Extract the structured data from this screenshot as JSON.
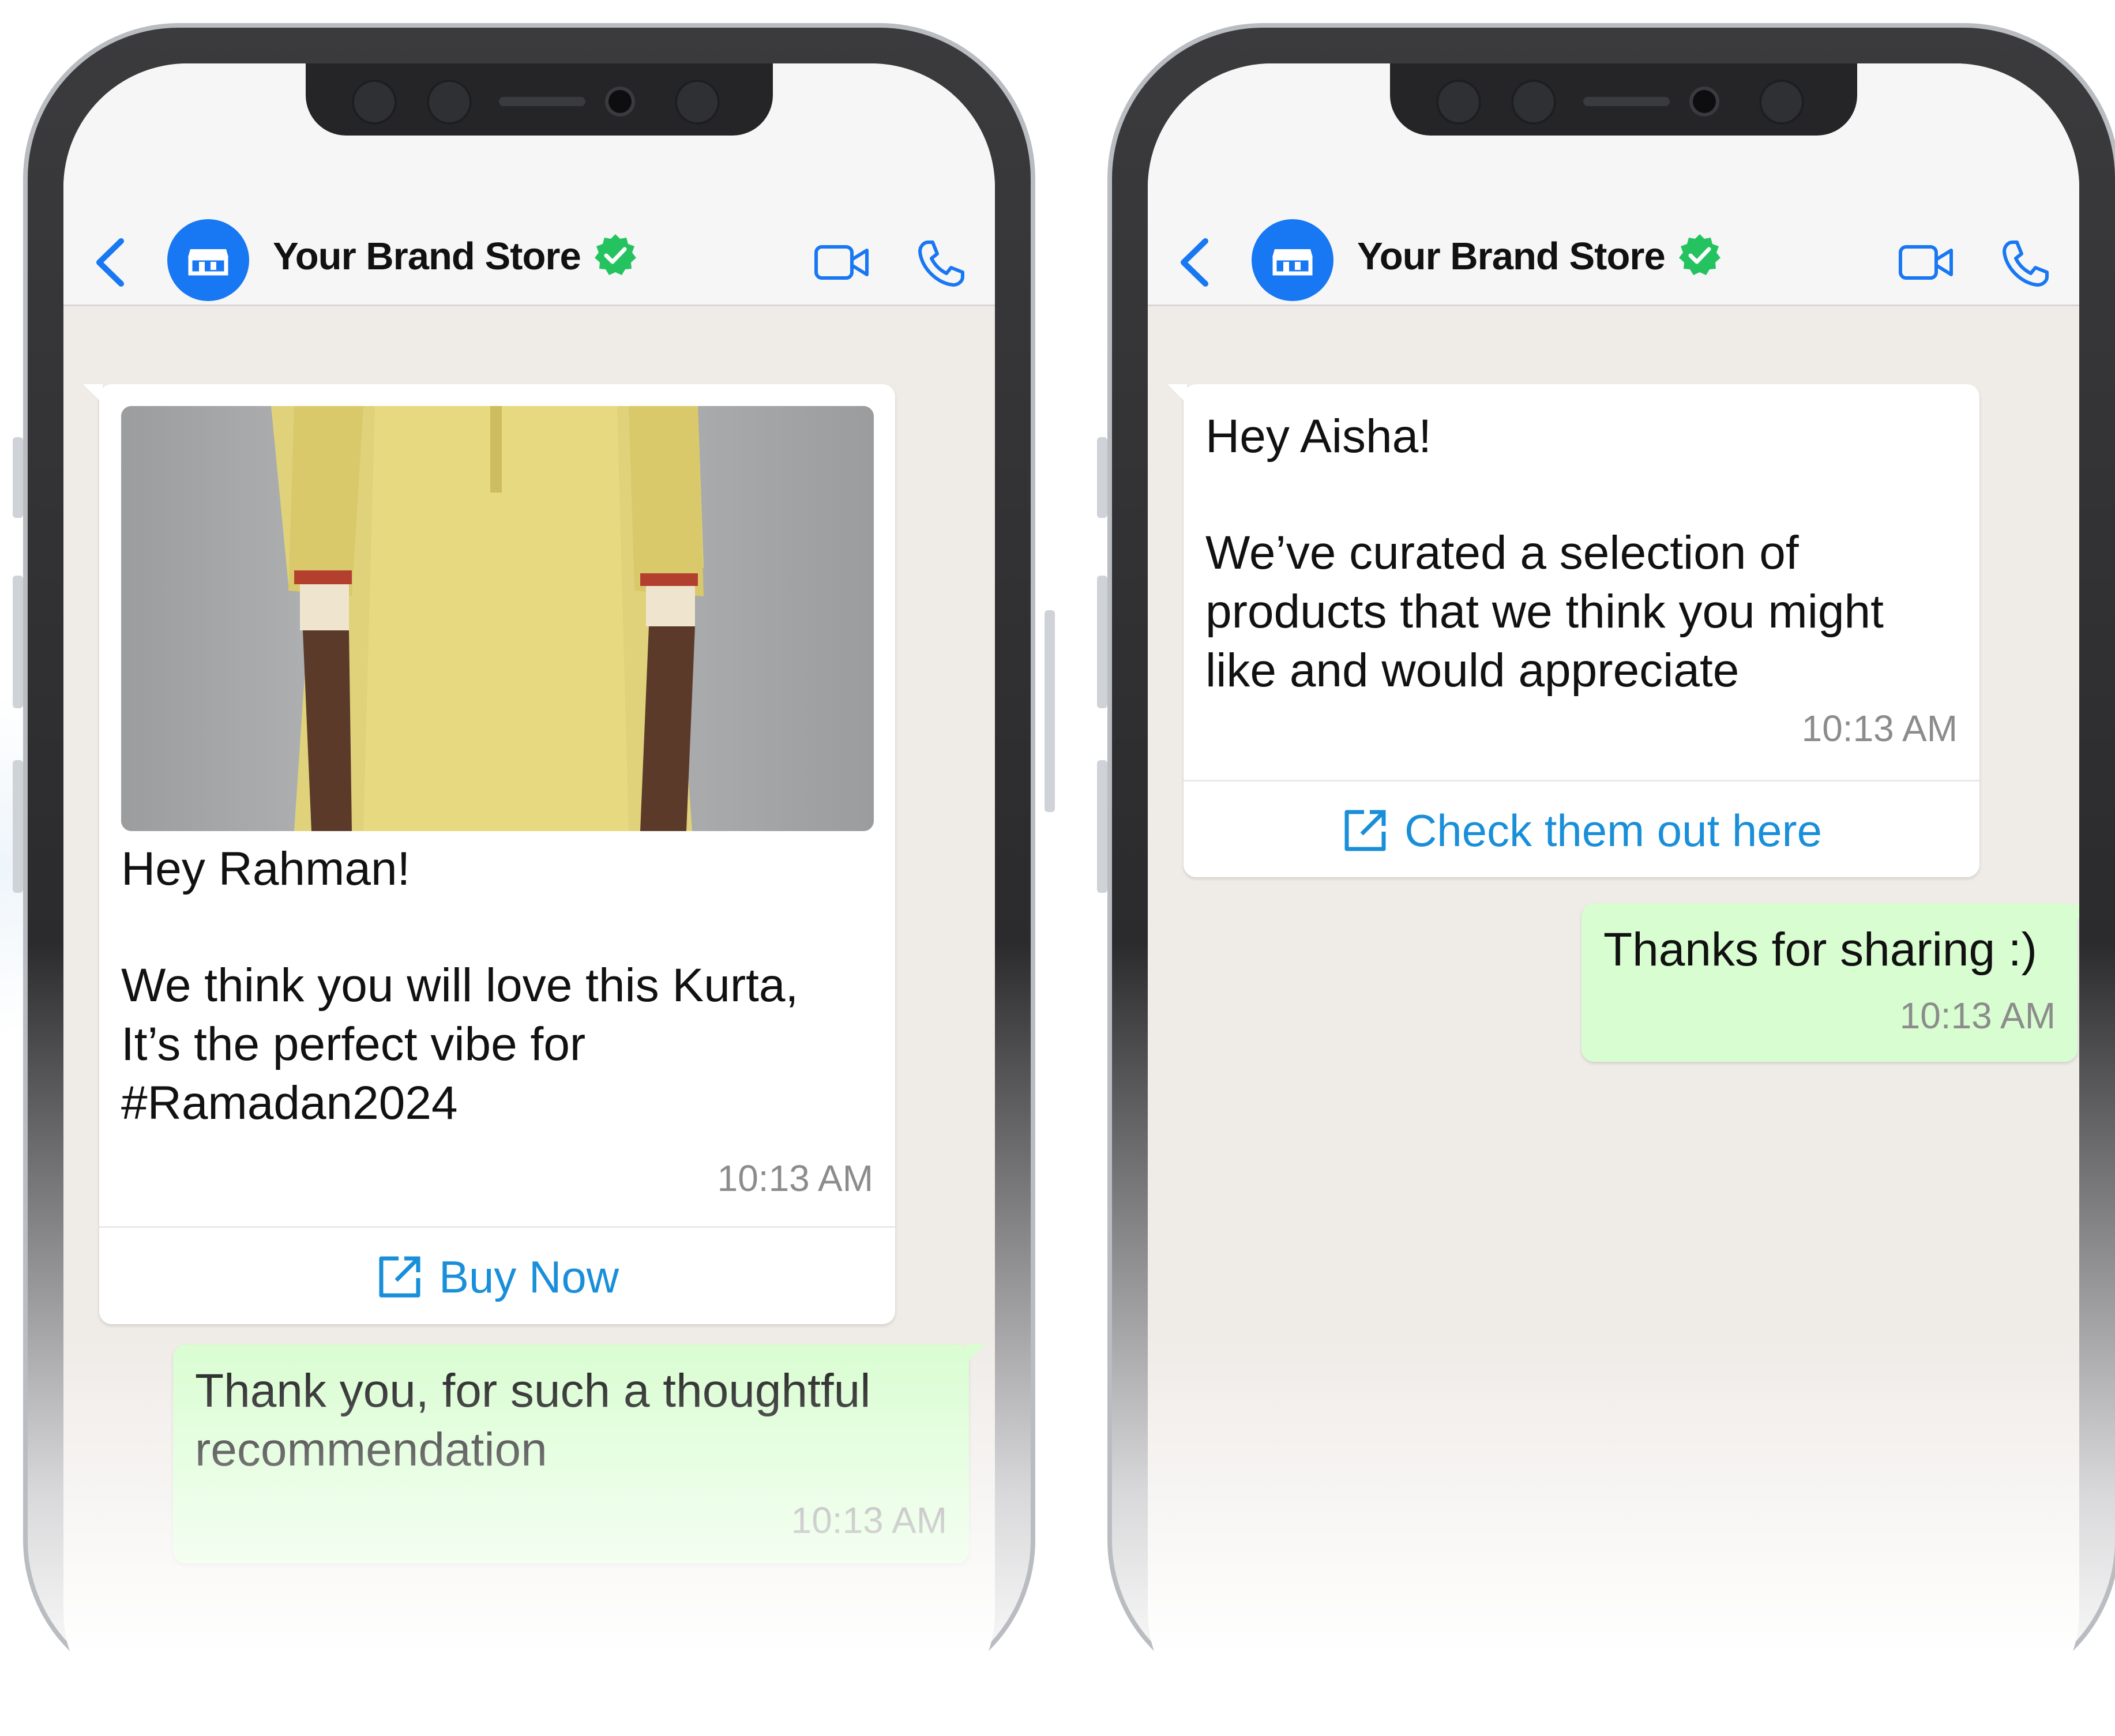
{
  "colors": {
    "brand_blue": "#1877f2",
    "verified_green": "#25c360",
    "outgoing_bubble": "#d8fdd0",
    "link_blue": "#1a8fd9",
    "chat_bg": "#efebe7"
  },
  "phones": [
    {
      "header": {
        "back_icon": "chevron-left-icon",
        "avatar_icon": "store-icon",
        "title": "Your Brand Store",
        "verified_icon": "verified-badge-icon",
        "video_icon": "video-call-icon",
        "call_icon": "phone-call-icon"
      },
      "messages": {
        "incoming": {
          "image": "yellow kurta product photo",
          "greeting": "Hey Rahman!",
          "body": "We think you will love this Kurta,\nIt’s the perfect vibe for\n#Ramadan2024",
          "time": "10:13 AM",
          "cta_icon": "external-link-icon",
          "cta_label": "Buy Now"
        },
        "outgoing": {
          "text": "Thank you, for such a thoughtful\nrecommendation",
          "time": "10:13 AM"
        }
      }
    },
    {
      "header": {
        "back_icon": "chevron-left-icon",
        "avatar_icon": "store-icon",
        "title": "Your Brand Store",
        "verified_icon": "verified-badge-icon",
        "video_icon": "video-call-icon",
        "call_icon": "phone-call-icon"
      },
      "messages": {
        "incoming": {
          "greeting": "Hey Aisha!",
          "body": "We’ve curated a selection of\nproducts that we think you might\nlike and would appreciate",
          "time": "10:13 AM",
          "cta_icon": "external-link-icon",
          "cta_label": "Check them out here"
        },
        "outgoing": {
          "text": "Thanks for sharing :)",
          "time": "10:13 AM"
        }
      }
    }
  ]
}
